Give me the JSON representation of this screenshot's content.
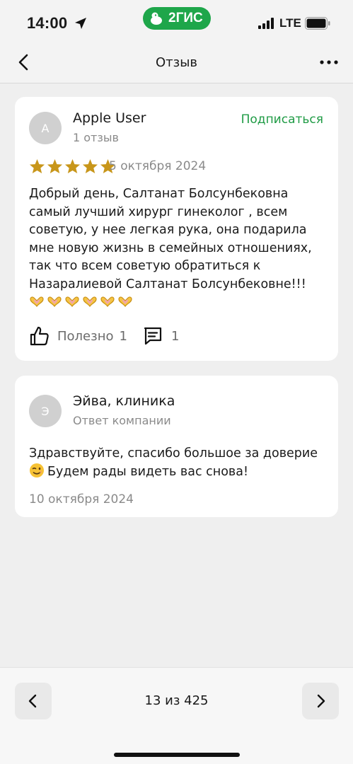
{
  "status_bar": {
    "time": "14:00",
    "brand": "2ГИС",
    "network": "LTE",
    "icons": [
      "location-arrow-icon",
      "signal-bars-icon",
      "battery-icon"
    ]
  },
  "header": {
    "title": "Отзыв",
    "icons": [
      "chevron-left-icon",
      "more-dots-icon"
    ]
  },
  "review": {
    "avatar_letter": "A",
    "author": "Apple User",
    "author_reviews": "1 отзыв",
    "subscribe_label": "Подписаться",
    "rating": 5,
    "rating_max": 5,
    "date": "5 октября 2024",
    "text": "Добрый день, Салтанат Болсунбековна самый лучший хирург гинеколог , всем советую, у нее легкая рука, она подарила мне новую жизнь в семейных отношениях, так что всем советую обратиться к Назаралиевой Салтанат Болсунбековне!!!",
    "emoji_count": 6,
    "emoji_name": "heart-hands-icon",
    "useful_label": "Полезно",
    "useful_count": "1",
    "comment_count": "1"
  },
  "reply": {
    "avatar_letter": "Э",
    "author": "Эйва, клиника",
    "author_role": "Ответ компании",
    "text_line1": "Здравствуйте, спасибо большое за доверие",
    "text_line2": "Будем рады видеть вас снова!",
    "emoji_name": "winking-face-icon",
    "date": "10 октября 2024"
  },
  "pager": {
    "label": "13 из 425"
  },
  "colors": {
    "accent_green": "#1f9b45",
    "brand_green": "#1ea64a",
    "star_gold": "#c8961a",
    "background": "#efefef"
  }
}
